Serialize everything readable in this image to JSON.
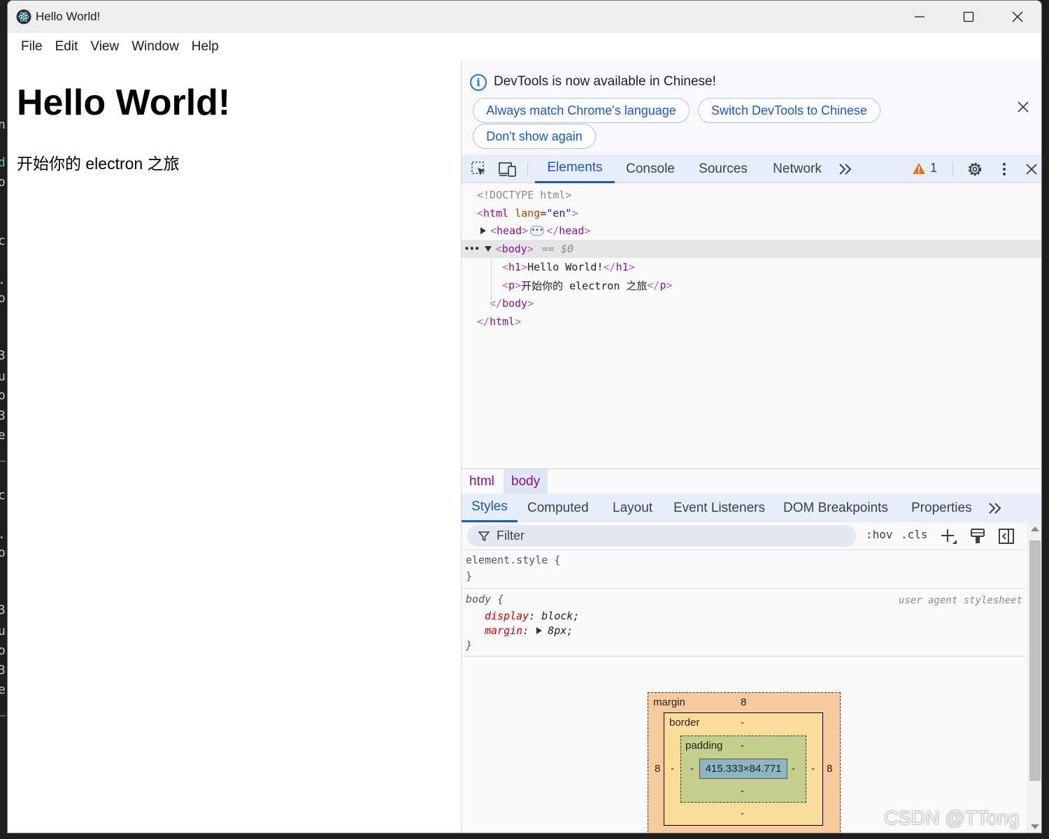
{
  "window": {
    "title": "Hello World!"
  },
  "menu": [
    "File",
    "Edit",
    "View",
    "Window",
    "Help"
  ],
  "page": {
    "heading": "Hello World!",
    "paragraph": "开始你的 electron 之旅"
  },
  "devtools": {
    "infobar": {
      "message": "DevTools is now available in Chinese!",
      "buttons": [
        "Always match Chrome's language",
        "Switch DevTools to Chinese",
        "Don't show again"
      ]
    },
    "tabs": [
      "Elements",
      "Console",
      "Sources",
      "Network"
    ],
    "active_tab": "Elements",
    "warnings_count": "1",
    "dom": {
      "doctype": "<!DOCTYPE html>",
      "html_tag": "html",
      "lang_attr": "lang",
      "lang_value": "\"en\"",
      "head_tag": "head",
      "body_tag": "body",
      "body_ref": "== $0",
      "h1_tag": "h1",
      "h1_text": "Hello World!",
      "p_tag": "p",
      "p_text": "开始你的 electron 之旅"
    },
    "breadcrumbs": [
      "html",
      "body"
    ],
    "subtabs": [
      "Styles",
      "Computed",
      "Layout",
      "Event Listeners",
      "DOM Breakpoints",
      "Properties"
    ],
    "active_subtab": "Styles",
    "filter_placeholder": "Filter",
    "hov_label": ":hov",
    "cls_label": ".cls",
    "styles": {
      "element_style": "element.style {",
      "close_brace": "}",
      "body_selector": "body {",
      "ua_label": "user agent stylesheet",
      "display_name": "display",
      "display_value": "block;",
      "margin_name": "margin",
      "margin_value": "8px;"
    },
    "box_model": {
      "margin_label": "margin",
      "margin_top": "8",
      "margin_left": "8",
      "margin_right": "8",
      "border_label": "border",
      "border_top": "-",
      "border_left": "-",
      "border_right": "-",
      "border_bottom": "-",
      "padding_label": "padding",
      "padding_top": "-",
      "padding_left": "-",
      "padding_right": "-",
      "padding_bottom": "-",
      "content_size": "415.333×84.771"
    }
  },
  "watermark": "CSDN @TTong"
}
